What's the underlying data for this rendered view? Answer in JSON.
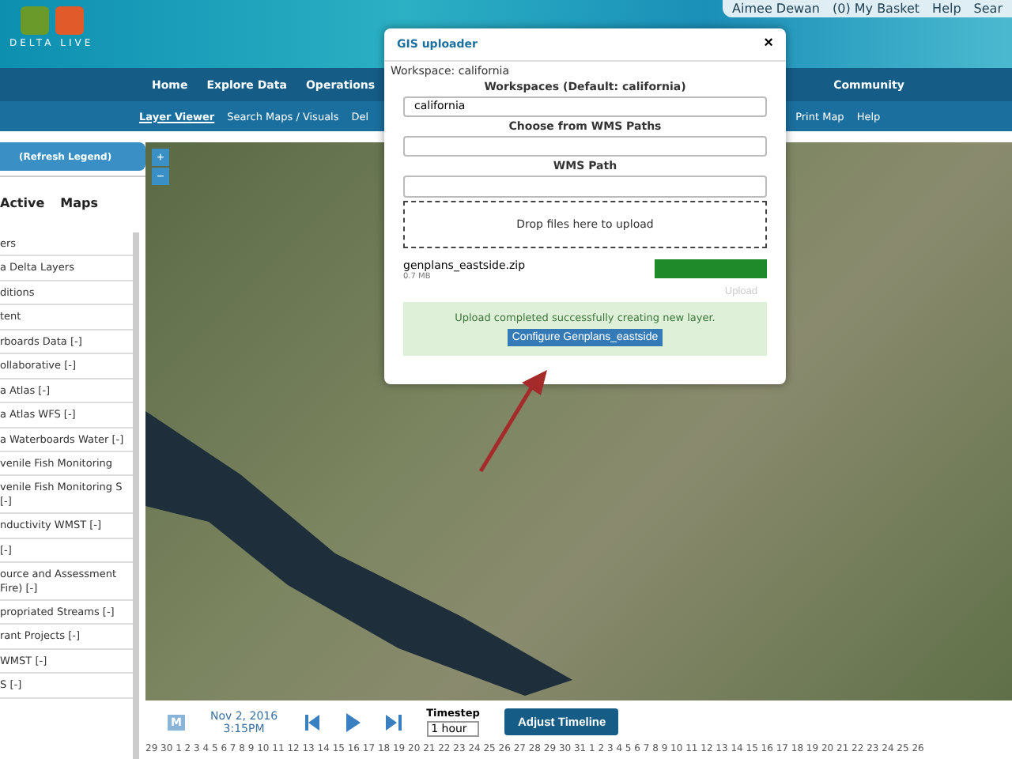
{
  "header": {
    "logo_text": "DELTA LIVE",
    "user": "Aimee Dewan",
    "basket": "(0) My Basket",
    "help": "Help",
    "search": "Sear"
  },
  "nav": [
    {
      "label": "Home"
    },
    {
      "label": "Explore Data"
    },
    {
      "label": "Operations"
    },
    {
      "label": "Community"
    }
  ],
  "subnav": [
    {
      "label": "Layer Viewer",
      "selected": true
    },
    {
      "label": "Search Maps / Visuals",
      "selected": false
    },
    {
      "label": "Del",
      "selected": false
    },
    {
      "label": "Print Map",
      "selected": false
    },
    {
      "label": "Help",
      "selected": false
    }
  ],
  "sidebar": {
    "refresh": "(Refresh Legend)",
    "tabs": [
      {
        "label": "Active",
        "selected": false
      },
      {
        "label": "Maps",
        "selected": false
      }
    ],
    "items": [
      "ers",
      "a Delta Layers",
      "ditions",
      "tent",
      "rboards Data [-]",
      "ollaborative [-]",
      "a Atlas [-]",
      "a Atlas WFS [-]",
      "a Waterboards Water [-]",
      "venile Fish Monitoring",
      "venile Fish Monitoring S [-]",
      "nductivity WMST [-]",
      "[-]",
      "ource and Assessment Fire) [-]",
      "propriated Streams [-]",
      "rant Projects [-]",
      "WMST [-]",
      "S [-]"
    ]
  },
  "map": {
    "zoom_in": "+",
    "zoom_out": "−"
  },
  "dialog": {
    "title": "GIS uploader",
    "close": "×",
    "workspace": "Workspace: california",
    "workspaces_label": "Workspaces (Default: california)",
    "workspace_value": "california",
    "wms_paths_label": "Choose from WMS Paths",
    "wms_path_label": "WMS Path",
    "drop": "Drop files here to upload",
    "file": {
      "name": "genplans_eastside.zip",
      "size": "0.7 MB",
      "level": 1
    },
    "upload": "Upload",
    "message": "Upload completed successfully creating new layer.",
    "configure": "Configure Genplans_eastside"
  },
  "timeline": {
    "badge": "M",
    "date": "Nov 2, 2016",
    "time": "3:15PM",
    "timestep_label": "Timestep",
    "timestep": "1 hour",
    "adjust": "Adjust Timeline",
    "days": "29 30 1 2 3 4 5 6 7 8 9 10 11 12 13 14 15 16 17 18 19 20 21 22 23 24 25 26 27 28 29 30 31 1 2 3 4 5 6 7 8 9 10 11 12 13 14 15 16 17 18 19 20 21 22 23 24 25 26"
  }
}
